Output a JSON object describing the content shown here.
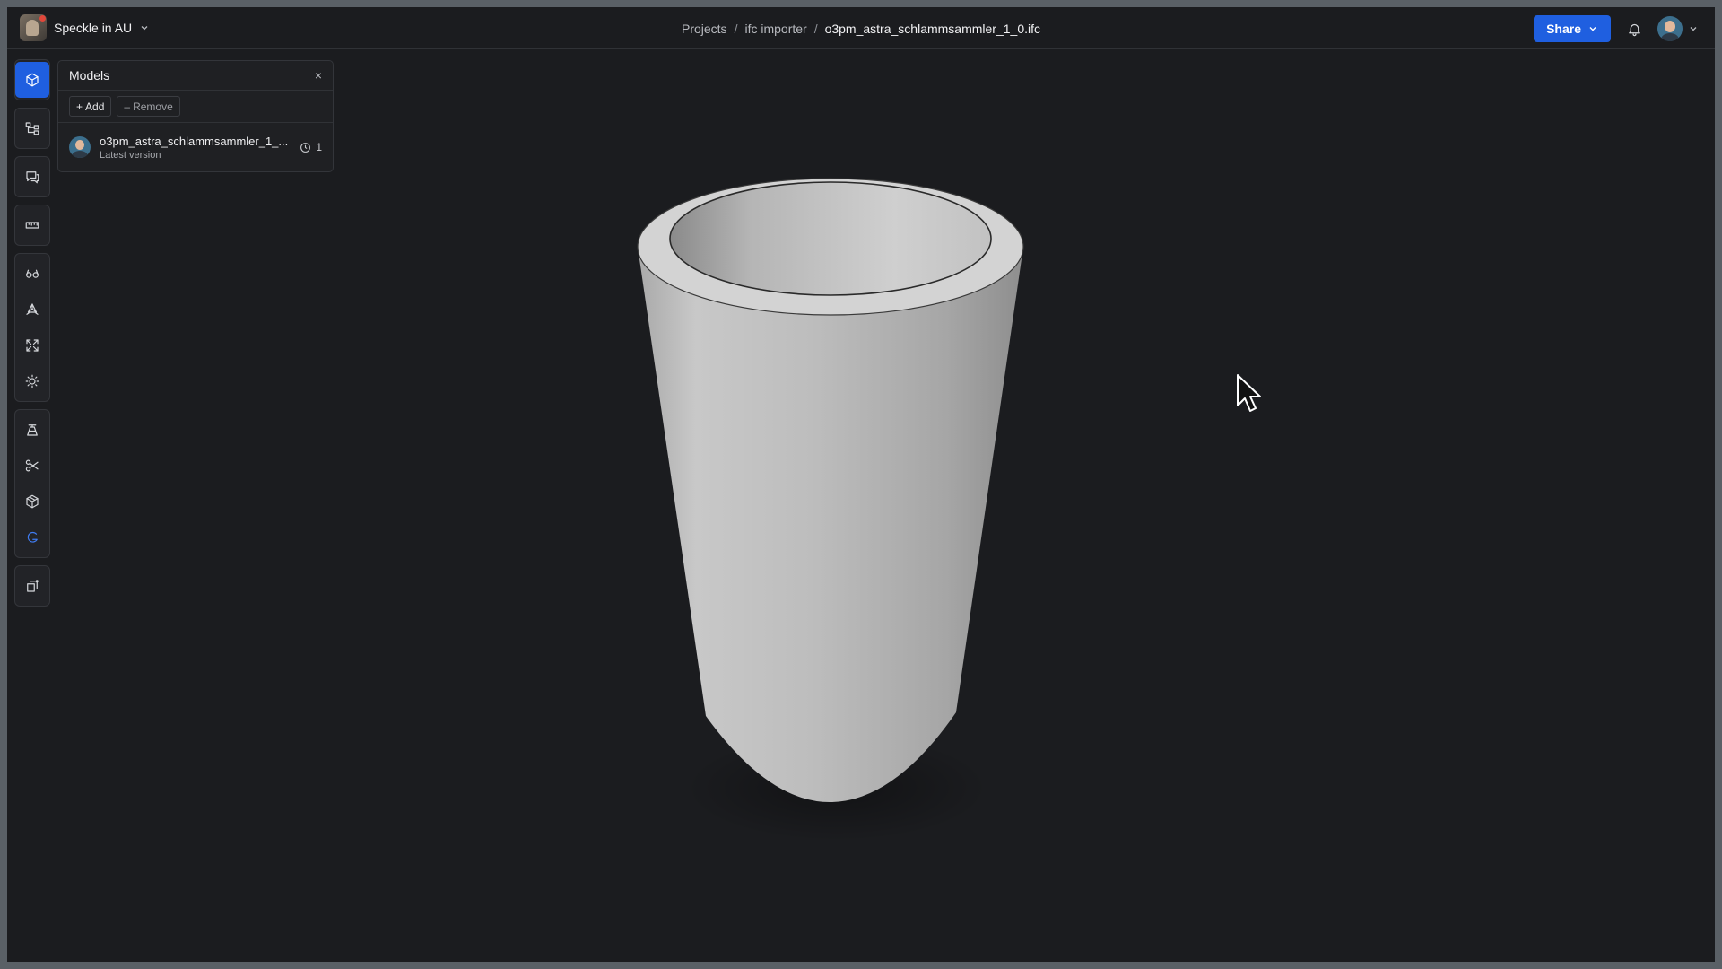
{
  "workspace": {
    "name": "Speckle in AU"
  },
  "breadcrumb": {
    "items": [
      "Projects",
      "ifc importer"
    ],
    "separator": "/",
    "current": "o3pm_astra_schlammsammler_1_0.ifc"
  },
  "header": {
    "share_label": "Share"
  },
  "toolbar": {
    "icons": [
      "models-icon",
      "scene-explorer-icon",
      "discussions-icon",
      "measure-icon",
      "views-icon",
      "explode-icon",
      "zoom-extents-icon",
      "light-icon",
      "section-box-icon",
      "clip-icon",
      "view-modes-icon",
      "gendo-ai-icon",
      "filter-icon"
    ]
  },
  "models_panel": {
    "title": "Models",
    "close_label": "×",
    "add_label": "Add",
    "remove_label": "Remove",
    "models": [
      {
        "name": "o3pm_astra_schlammsammler_1_...",
        "version_label": "Latest version",
        "version_count": "1"
      }
    ]
  },
  "colors": {
    "accent": "#1f5fe0",
    "background": "#1b1c1f",
    "panel": "#1f2023"
  }
}
